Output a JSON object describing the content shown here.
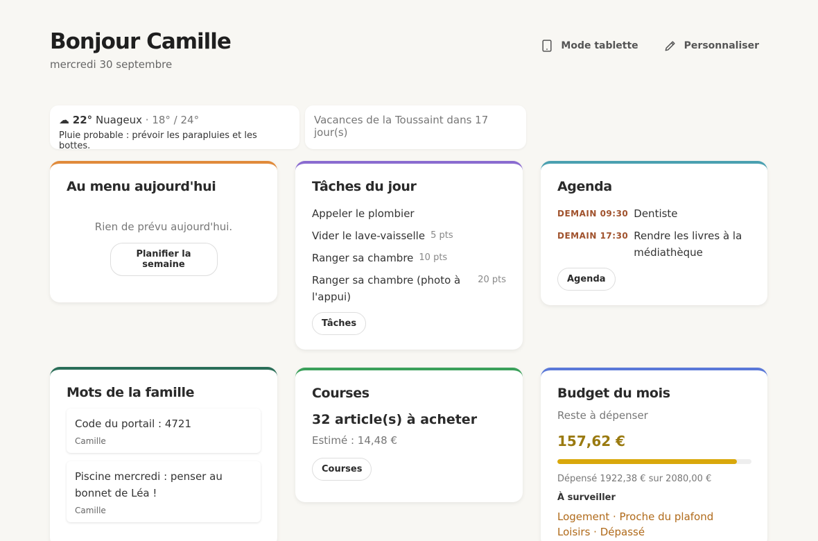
{
  "header": {
    "greeting": "Bonjour Camille",
    "date": "mercredi 30 septembre",
    "actions": [
      {
        "label": "Mode tablette",
        "icon": "tablet-icon"
      },
      {
        "label": "Personnaliser",
        "icon": "pencil-icon"
      }
    ]
  },
  "weather": {
    "icon": "☁",
    "temp": "22°",
    "condition": "Nuageux",
    "range": "· 18° / 24°",
    "advice": "Pluie probable : prévoir les parapluies et les bottes."
  },
  "holiday": {
    "text": "Vacances de la Toussaint dans 17 jour(s)"
  },
  "menu": {
    "title": "Au menu aujourd'hui",
    "empty": "Rien de prévu aujourd'hui.",
    "button": "Planifier la semaine"
  },
  "tasks": {
    "title": "Tâches du jour",
    "items": [
      {
        "label": "Appeler le plombier",
        "pts": ""
      },
      {
        "label": "Vider le lave-vaisselle",
        "pts": "5 pts"
      },
      {
        "label": "Ranger sa chambre",
        "pts": "10 pts"
      },
      {
        "label": "Ranger sa chambre (photo à l'appui)",
        "pts": "20 pts"
      }
    ],
    "button": "Tâches"
  },
  "agenda": {
    "title": "Agenda",
    "events": [
      {
        "time": "DEMAIN 09:30",
        "what": "Dentiste"
      },
      {
        "time": "DEMAIN 17:30",
        "what": "Rendre les livres à la médiathèque"
      }
    ],
    "button": "Agenda"
  },
  "words": {
    "title": "Mots de la famille",
    "notes": [
      {
        "text": "Code du portail : 4721",
        "author": "Camille"
      },
      {
        "text": "Piscine mercredi : penser au bonnet de Léa !",
        "author": "Camille"
      }
    ]
  },
  "shopping": {
    "title": "Courses",
    "count": "32 article(s) à acheter",
    "estimate": "Estimé : 14,48 €",
    "button": "Courses"
  },
  "budget": {
    "title": "Budget du mois",
    "remaining_label": "Reste à dépenser",
    "remaining": "157,62 €",
    "spent_fraction": 0.924,
    "spent_text": "Dépensé 1922,38 € sur 2080,00 €",
    "watch_label": "À surveiller",
    "alerts": [
      "Logement · Proche du plafond",
      "Loisirs · Dépassé"
    ],
    "bar_color": "#d9a80b"
  }
}
